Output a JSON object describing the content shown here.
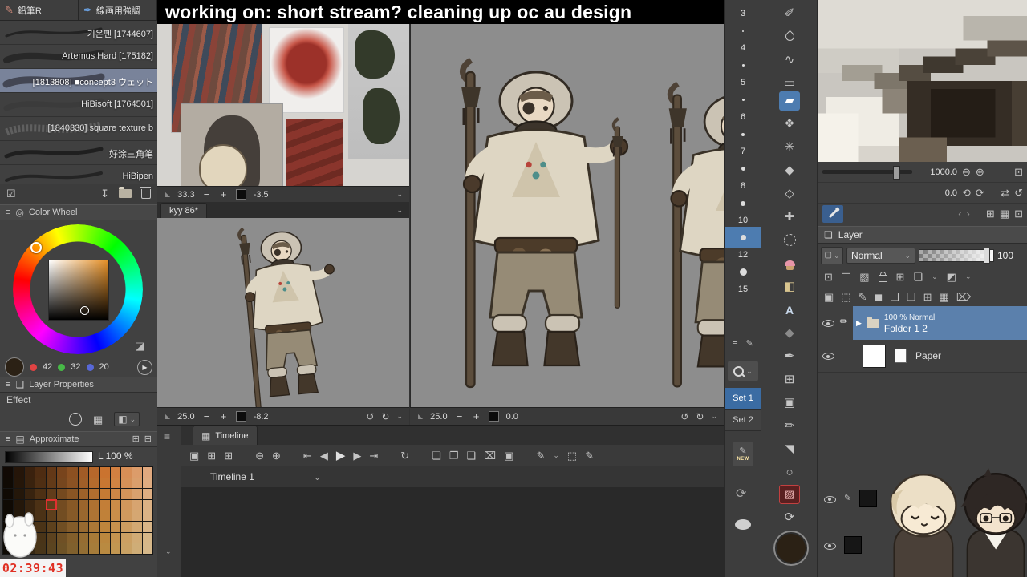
{
  "stream": {
    "title": "working on: short stream? cleaning up oc au design",
    "timer": "02:39:43"
  },
  "brush_panel": {
    "tabs": [
      {
        "label": "鉛筆R"
      },
      {
        "label": "線画用強調"
      }
    ],
    "brushes": [
      {
        "label": "기온펜 [1744607]"
      },
      {
        "label": "Artemus Hard [175182]"
      },
      {
        "label": "[1813808] ■concept3 ウェット"
      },
      {
        "label": "HiBisoft [1764501]"
      },
      {
        "label": "[1840330] square texture b"
      },
      {
        "label": "好涂三角笔"
      },
      {
        "label": "HiBipen"
      }
    ]
  },
  "color_wheel": {
    "title": "Color Wheel",
    "r": "42",
    "g": "32",
    "b": "20",
    "current_color": "#2b2115"
  },
  "layer_properties": {
    "title": "Layer Properties",
    "effect_label": "Effect"
  },
  "approximate": {
    "title": "Approximate",
    "luminosity_label": "L 100 %"
  },
  "viewports": {
    "reference": {
      "zoom": "33.3",
      "angle": "-3.5"
    },
    "canvas_tab": "kyy 86*",
    "left": {
      "zoom": "25.0",
      "angle": "-8.2"
    },
    "right": {
      "zoom": "25.0",
      "angle": "0.0"
    }
  },
  "timeline": {
    "tab_label": "Timeline",
    "track_selector": "Timeline 1"
  },
  "brush_sizes": {
    "items": [
      {
        "size": "3",
        "dot": 2
      },
      {
        "size": "4",
        "dot": 2
      },
      {
        "size": "5",
        "dot": 3
      },
      {
        "size": "6",
        "dot": 3
      },
      {
        "size": "7",
        "dot": 4
      },
      {
        "size": "8",
        "dot": 5
      },
      {
        "size": "10",
        "dot": 6
      },
      {
        "size": "12",
        "dot": 7
      },
      {
        "size": "15",
        "dot": 9
      }
    ],
    "selected": "12",
    "sets": [
      {
        "label": "Set 1"
      },
      {
        "label": "Set 2"
      }
    ],
    "new_badge": "NEW"
  },
  "navigator": {
    "zoom_value": "1000.0",
    "rotate_value": "0.0"
  },
  "layer_panel": {
    "title": "Layer",
    "blend_mode": "Normal",
    "opacity": "100",
    "layers": [
      {
        "meta": "100 % Normal",
        "name": "Folder 1 2"
      },
      {
        "meta": "",
        "name": "Paper"
      }
    ]
  },
  "text_tool_glyph": "A"
}
